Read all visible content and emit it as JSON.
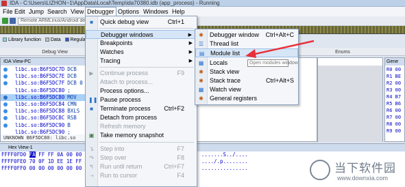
{
  "window": {
    "title": "IDA - C:\\Users\\LIZHON~1\\AppData\\Local\\Temp\\ida70380.idb (app_process) - Running"
  },
  "menubar": [
    "File",
    "Edit",
    "Jump",
    "Search",
    "View",
    "Debugger",
    "Options",
    "Windows",
    "Help"
  ],
  "toolbar": {
    "debugger_select": "Remote ARMLinux/Android debugger"
  },
  "legend": [
    "Library function",
    "Data",
    "Regular function"
  ],
  "tabs": {
    "debug_view": "Debug View",
    "enums": "Enums"
  },
  "ida_view": {
    "title": "IDA View-PC",
    "lines": [
      {
        "addr": "libc.so:B6F5DC7D",
        "op": "DCB"
      },
      {
        "addr": "libc.so:B6F5DC7E",
        "op": "DCB"
      },
      {
        "addr": "libc.so:B6F5DC7F",
        "op": "DCB 0"
      },
      {
        "addr": "libc.so:B6F5DC80",
        "op": ";"
      },
      {
        "addr": "libc.so:B6F5DC80",
        "op": "MOV"
      },
      {
        "addr": "libc.so:B6F5DC84",
        "op": "CMN"
      },
      {
        "addr": "libc.so:B6F5DC88",
        "op": "BXLS"
      },
      {
        "addr": "libc.so:B6F5DC8C",
        "op": "RSB"
      },
      {
        "addr": "libc.so:B6F5DC90",
        "op": "B"
      },
      {
        "addr": "libc.so:B6F5DC90",
        "op": ";"
      }
    ],
    "status": "UNKNOWN B6F5DC80: libc.so"
  },
  "registers": [
    "R0 00",
    "R1 BE",
    "R2 00",
    "R3 00",
    "R4 B7",
    "R5 B6",
    "R6 00",
    "R7 00",
    "R8 00",
    "R9 00"
  ],
  "register_panel_title": "Gene",
  "hex_view": {
    "title": "Hex View-1",
    "lines": [
      {
        "addr": "FFFF0FD0",
        "sel": "FA",
        "rest": " FF FF 0A 00 00",
        "ascii": ".......S../...."
      },
      {
        "addr": "FFFF0FE0",
        "sel": "",
        "rest": "70 0F 1D EE 1E FF",
        "ascii": "..../.p........"
      },
      {
        "addr": "FFFF0FF0",
        "sel": "",
        "rest": "00 00 00 00 00 00",
        "ascii": "..............."
      }
    ]
  },
  "debugger_menu": {
    "items": [
      {
        "label": "Quick debug view",
        "shortcut": "Ctrl+1",
        "icon": "quick-debug-icon",
        "disabled": false,
        "submenu": false
      },
      {
        "label": "Debugger windows",
        "shortcut": "",
        "icon": "",
        "disabled": false,
        "submenu": true,
        "highlighted": true
      },
      {
        "label": "Breakpoints",
        "shortcut": "",
        "icon": "",
        "disabled": false,
        "submenu": true
      },
      {
        "label": "Watches",
        "shortcut": "",
        "icon": "",
        "disabled": false,
        "submenu": true
      },
      {
        "label": "Tracing",
        "shortcut": "",
        "icon": "",
        "disabled": false,
        "submenu": true
      },
      {
        "label": "Continue process",
        "shortcut": "F9",
        "icon": "play-icon",
        "disabled": true,
        "submenu": false
      },
      {
        "label": "Attach to process...",
        "shortcut": "",
        "icon": "",
        "disabled": true,
        "submenu": false
      },
      {
        "label": "Process options...",
        "shortcut": "",
        "icon": "",
        "disabled": false,
        "submenu": false
      },
      {
        "label": "Pause process",
        "shortcut": "",
        "icon": "pause-icon",
        "disabled": false,
        "submenu": false
      },
      {
        "label": "Terminate process",
        "shortcut": "Ctrl+F2",
        "icon": "stop-icon",
        "disabled": false,
        "submenu": false
      },
      {
        "label": "Detach from process",
        "shortcut": "",
        "icon": "",
        "disabled": false,
        "submenu": false
      },
      {
        "label": "Refresh memory",
        "shortcut": "",
        "icon": "",
        "disabled": true,
        "submenu": false
      },
      {
        "label": "Take memory snapshot",
        "shortcut": "",
        "icon": "snapshot-icon",
        "disabled": false,
        "submenu": false
      },
      {
        "label": "Step into",
        "shortcut": "F7",
        "icon": "step-into-icon",
        "disabled": true,
        "submenu": false
      },
      {
        "label": "Step over",
        "shortcut": "F8",
        "icon": "step-over-icon",
        "disabled": true,
        "submenu": false
      },
      {
        "label": "Run until return",
        "shortcut": "Ctrl+F7",
        "icon": "run-until-return-icon",
        "disabled": true,
        "submenu": false
      },
      {
        "label": "Run to cursor",
        "shortcut": "F4",
        "icon": "run-to-cursor-icon",
        "disabled": true,
        "submenu": false
      }
    ]
  },
  "windows_submenu": {
    "items": [
      {
        "label": "Debugger window",
        "shortcut": "Ctrl+Alt+C",
        "icon": "bug-icon"
      },
      {
        "label": "Thread list",
        "shortcut": "",
        "icon": "thread-list-icon"
      },
      {
        "label": "Module list",
        "shortcut": "",
        "icon": "module-list-icon",
        "highlighted": true
      },
      {
        "label": "Locals",
        "shortcut": "",
        "icon": "locals-icon"
      },
      {
        "label": "Stack view",
        "shortcut": "",
        "icon": "stack-view-icon"
      },
      {
        "label": "Stack trace",
        "shortcut": "Ctrl+Alt+S",
        "icon": "stack-trace-icon"
      },
      {
        "label": "Watch view",
        "shortcut": "",
        "icon": "watch-view-icon"
      },
      {
        "label": "General registers",
        "shortcut": "",
        "icon": "registers-icon"
      }
    ],
    "tooltip": "Open modules window"
  },
  "watermark": {
    "brand": "当下软件园",
    "url": "www.downxia.com"
  },
  "colors": {
    "annotation": "#e8303a",
    "selection": "#a9d1f7",
    "code_blue": "#0000c8"
  }
}
